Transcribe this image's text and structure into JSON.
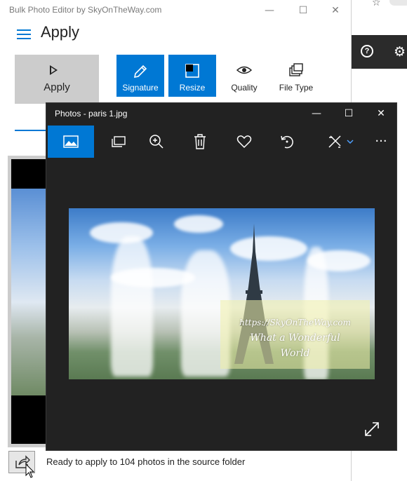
{
  "bulk_editor": {
    "window_title": "Bulk Photo Editor by SkyOnTheWay.com",
    "page_title": "Apply",
    "apply_label": "Apply",
    "tools": [
      {
        "label": "Signature"
      },
      {
        "label": "Resize"
      },
      {
        "label": "Quality"
      },
      {
        "label": "File Type"
      }
    ],
    "status": "Ready to apply to 104 photos in the source folder"
  },
  "photos": {
    "window_title": "Photos - paris 1.jpg",
    "watermark": [
      "https://SkyOnTheWay.com",
      "What a Wonderful",
      "World"
    ],
    "toolbar": [
      "image-icon",
      "slideshow-icon",
      "zoom-in-icon",
      "delete-icon",
      "favorite-icon",
      "rotate-icon",
      "edit-icon",
      "more-icon"
    ]
  },
  "colors": {
    "accent": "#0078d4",
    "photos_bg": "#222222"
  }
}
